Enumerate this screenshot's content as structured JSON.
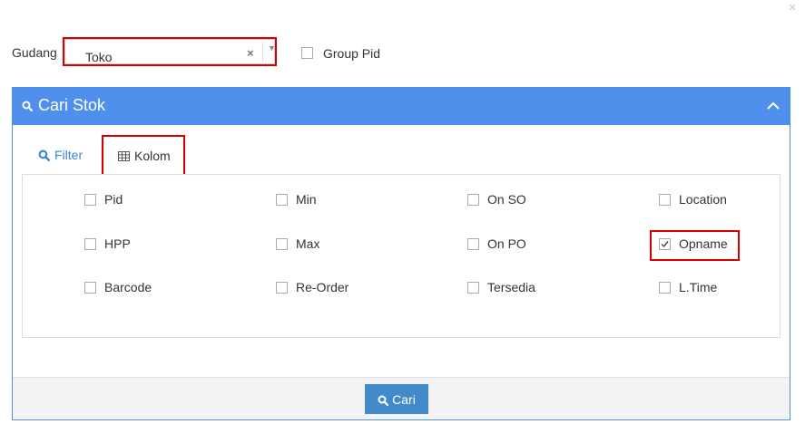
{
  "window": {
    "close_glyph": "×"
  },
  "gudang": {
    "label": "Gudang",
    "selected": "Toko",
    "clear_glyph": "×",
    "caret_glyph": "▼"
  },
  "group_pid": {
    "label": "Group Pid",
    "checked": false
  },
  "panel": {
    "title": "Cari Stok",
    "color": "#4e90ec",
    "tabs": [
      {
        "label": "Filter",
        "icon": "search-icon",
        "active": false
      },
      {
        "label": "Kolom",
        "icon": "table-icon",
        "active": true
      }
    ],
    "columns": [
      {
        "label": "Pid",
        "checked": false
      },
      {
        "label": "Min",
        "checked": false
      },
      {
        "label": "On SO",
        "checked": false
      },
      {
        "label": "Location",
        "checked": false
      },
      {
        "label": "HPP",
        "checked": false
      },
      {
        "label": "Max",
        "checked": false
      },
      {
        "label": "On PO",
        "checked": false
      },
      {
        "label": "Opname",
        "checked": true
      },
      {
        "label": "Barcode",
        "checked": false
      },
      {
        "label": "Re-Order",
        "checked": false
      },
      {
        "label": "Tersedia",
        "checked": false
      },
      {
        "label": "L.Time",
        "checked": false
      }
    ],
    "search_button": {
      "label": "Cari",
      "icon": "search-icon",
      "color": "#428bca"
    }
  },
  "highlight_color": "#d60000"
}
